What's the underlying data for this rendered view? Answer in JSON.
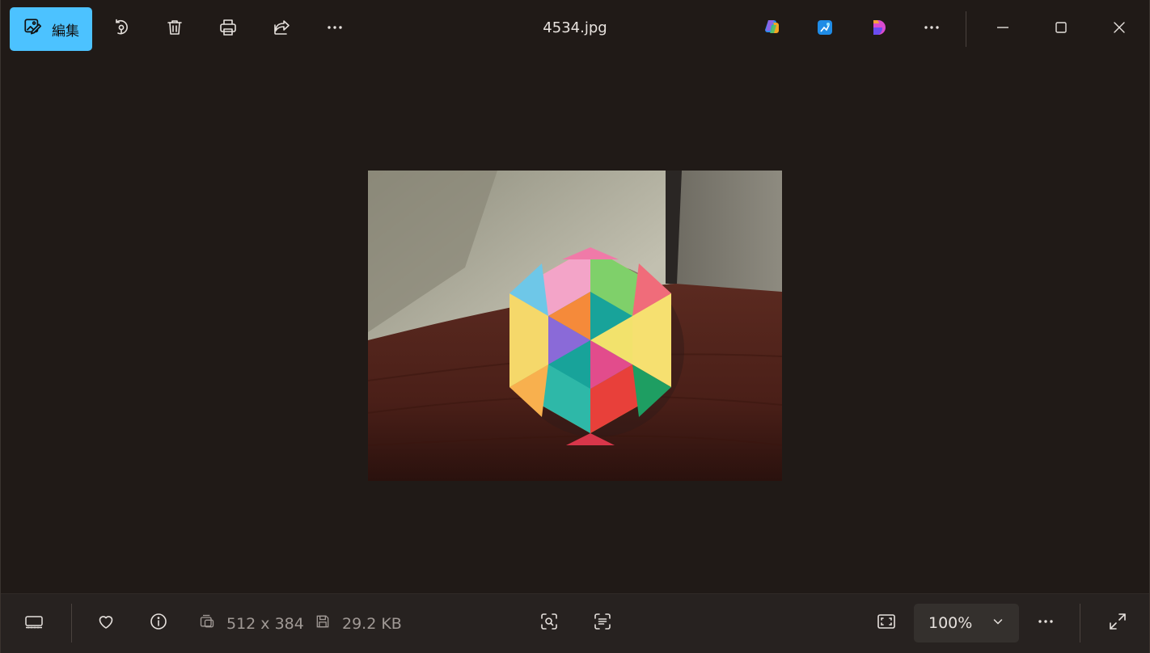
{
  "window": {
    "title": "4534.jpg"
  },
  "toolbar": {
    "edit_label": "編集"
  },
  "icons": {
    "edit": "edit-image-icon",
    "rotate": "rotate-icon",
    "delete": "trash-icon",
    "print": "print-icon",
    "share": "share-icon",
    "more": "more-icon",
    "copilot": "copilot-icon",
    "designer": "designer-icon",
    "clipchamp": "clipchamp-icon",
    "minimize": "minimize-icon",
    "maximize": "maximize-icon",
    "close": "close-icon",
    "filmstrip": "filmstrip-icon",
    "favorite": "heart-icon",
    "info": "info-icon",
    "resolution": "resolution-icon",
    "filesize": "save-icon",
    "visual_search": "visual-search-icon",
    "ocr": "text-scan-icon",
    "fit": "fit-to-window-icon",
    "chevron": "chevron-down-icon",
    "fullscreen": "fullscreen-icon"
  },
  "status": {
    "resolution": "512 x 384",
    "file_size": "29.2 KB",
    "zoom": "100%"
  },
  "colors": {
    "accent": "#4cc2ff",
    "background": "#201a17",
    "bottombar": "#272220"
  }
}
